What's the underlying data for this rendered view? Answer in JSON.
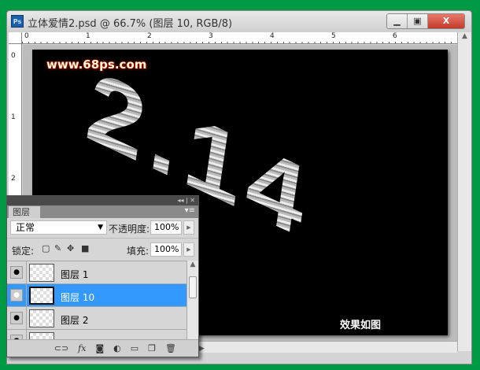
{
  "window": {
    "title": "立体爱情2.psd @ 66.7% (图层 10, RGB/8)",
    "app_icon": "Ps",
    "minimize": "▁",
    "restore": "▣",
    "close": "X"
  },
  "rulers": {
    "h_labels": [
      "0",
      "1",
      "2",
      "3",
      "4",
      "5",
      "6"
    ],
    "v_labels": [
      "0",
      "1",
      "2"
    ]
  },
  "canvas": {
    "watermark": "www.68ps.com",
    "art_text": "2.14",
    "caption": "效果如图"
  },
  "layers_panel": {
    "header_icons": "◂◂ | ✕",
    "tab": "图层",
    "menu_icon": "▾≡",
    "blend_mode": "正常",
    "opacity_label": "不透明度:",
    "opacity_value": "100%",
    "lock_label": "锁定:",
    "fill_label": "填充:",
    "fill_value": "100%",
    "layers": [
      {
        "name": "图层 1",
        "visible": true,
        "selected": false
      },
      {
        "name": "图层 10",
        "visible": true,
        "selected": true
      },
      {
        "name": "图层 2",
        "visible": true,
        "selected": false
      },
      {
        "name": "",
        "visible": true,
        "selected": false
      }
    ],
    "footer_icons": [
      "link-icon",
      "fx-icon",
      "mask-icon",
      "adjustment-icon",
      "group-icon",
      "new-layer-icon",
      "trash-icon"
    ]
  }
}
